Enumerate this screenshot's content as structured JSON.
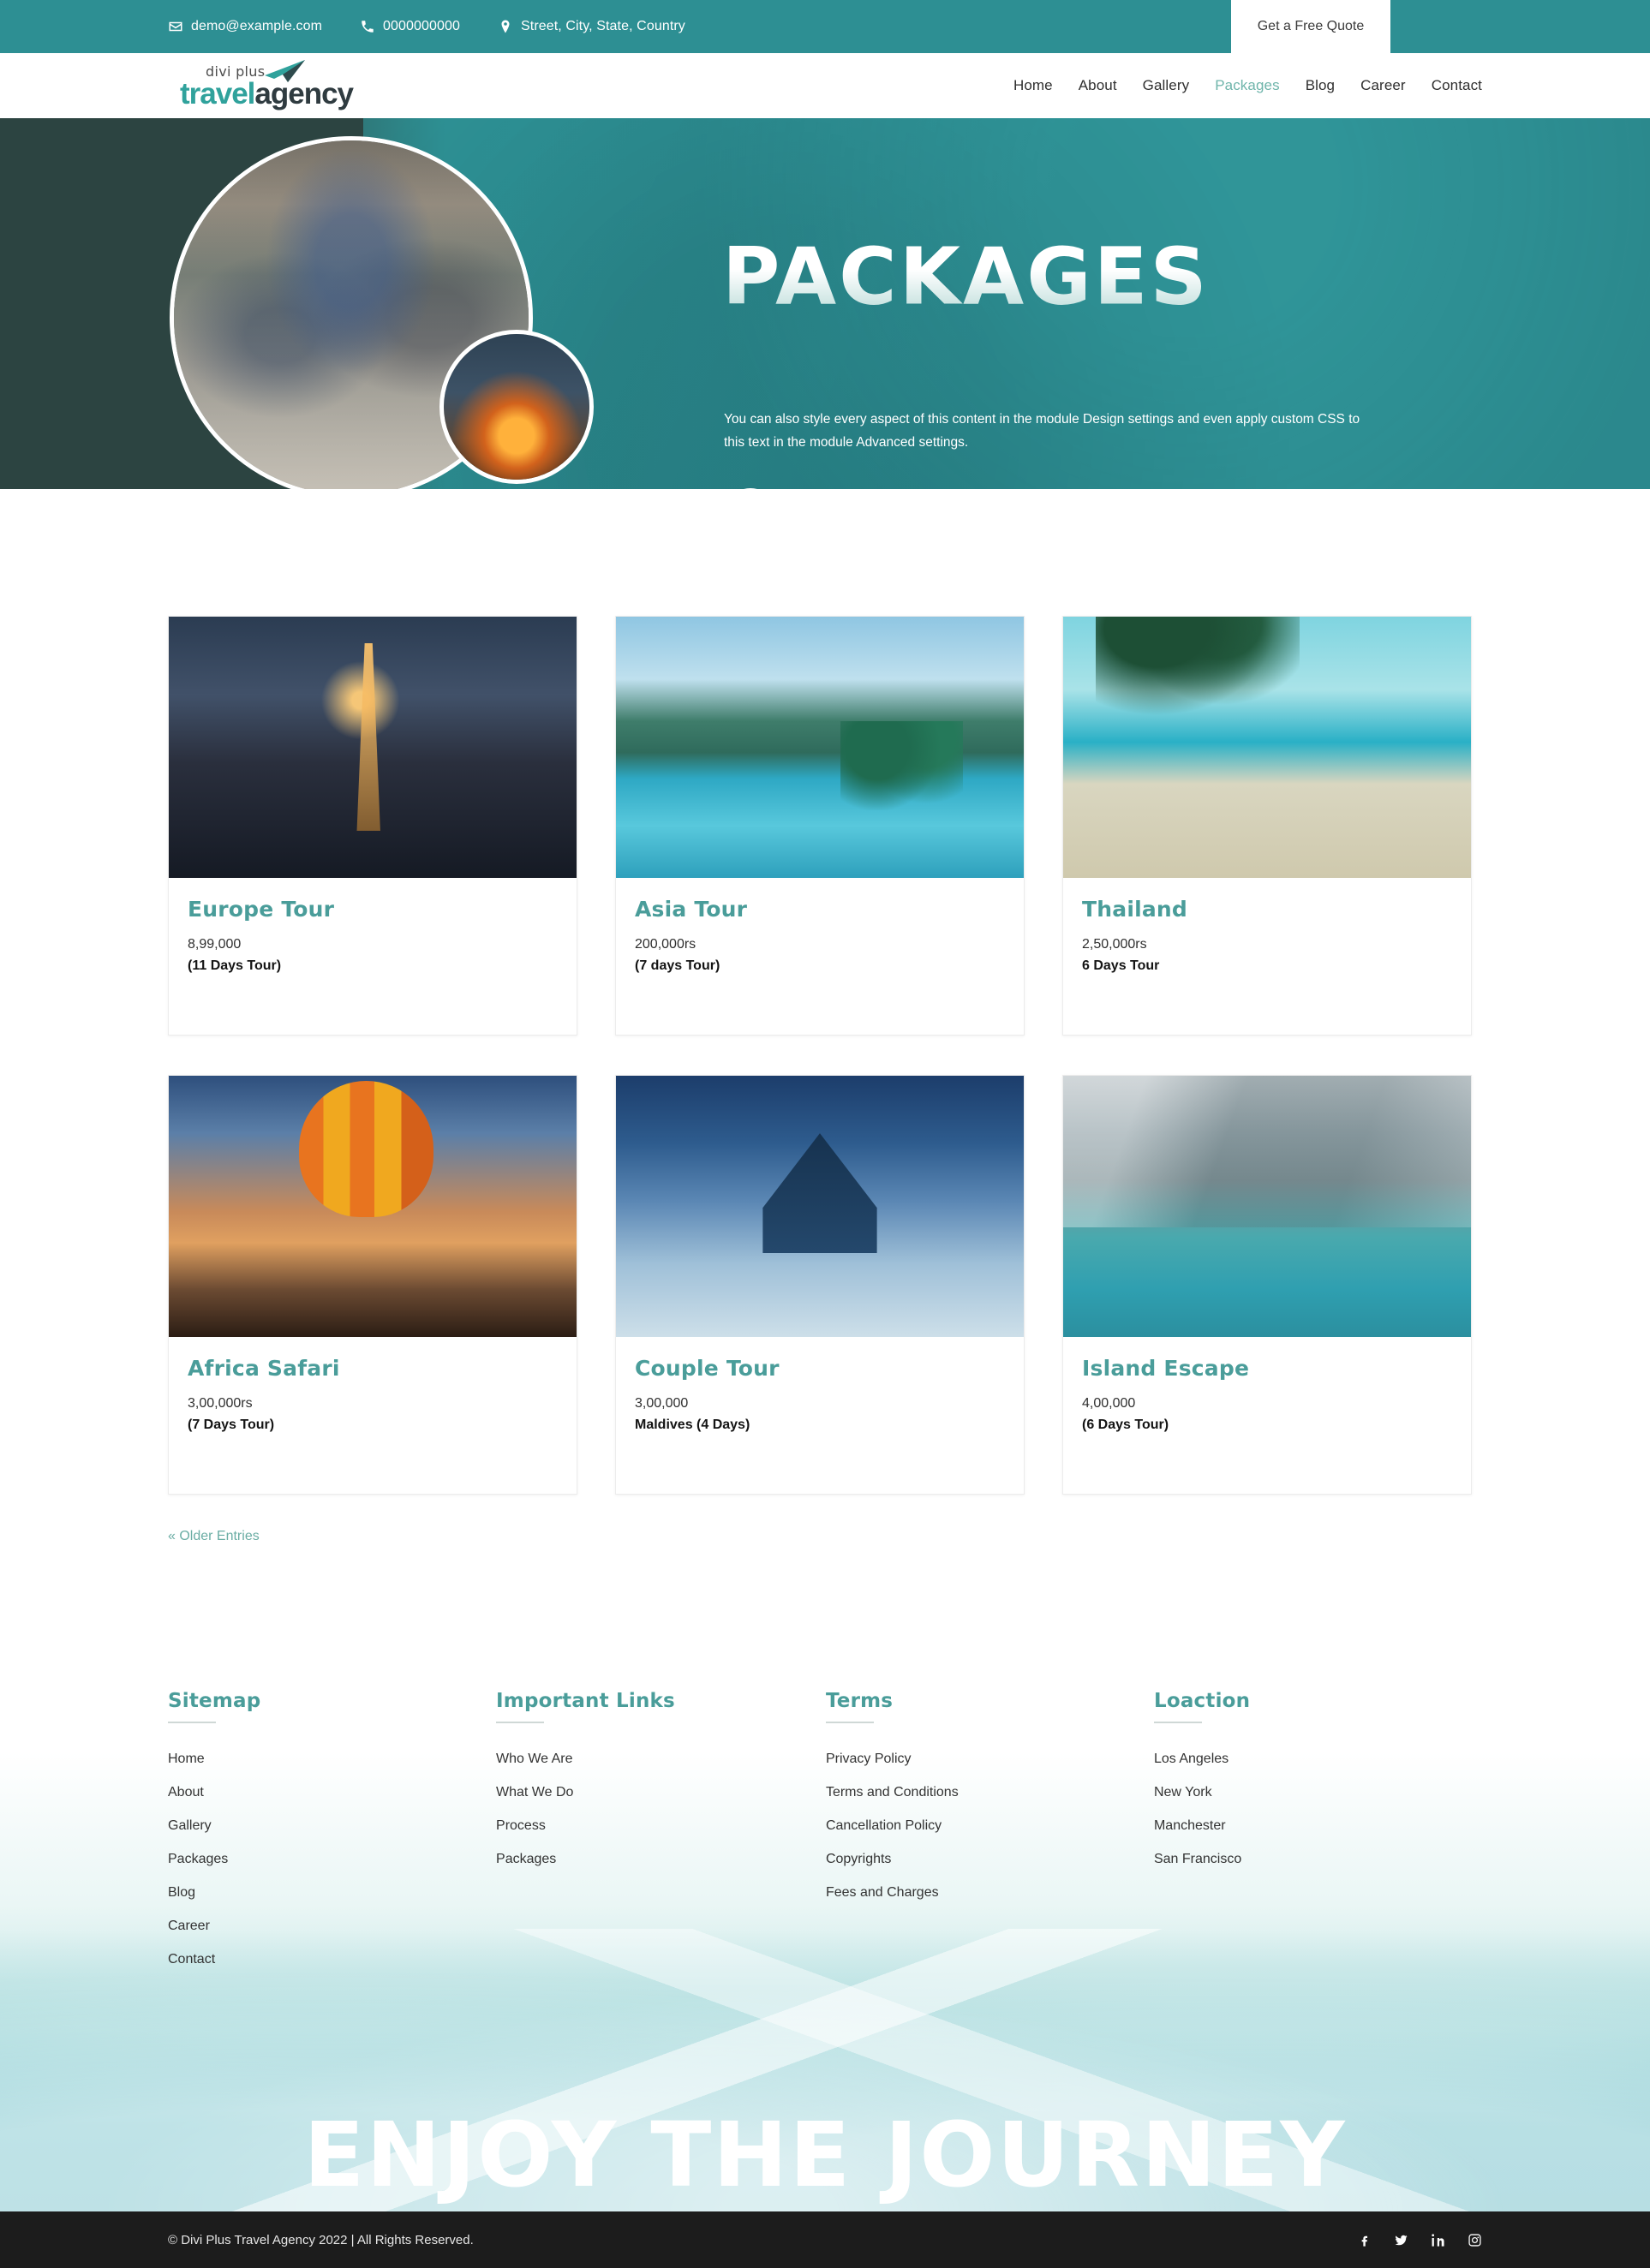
{
  "topbar": {
    "email": "demo@example.com",
    "phone": "0000000000",
    "address": "Street, City, State, Country",
    "quote_button": "Get a Free Quote",
    "bg_color": "#2d8f93"
  },
  "header": {
    "logo": {
      "small": "divi plus",
      "word1": "travel",
      "word2": "agency"
    },
    "nav": [
      {
        "label": "Home",
        "active": false
      },
      {
        "label": "About",
        "active": false
      },
      {
        "label": "Gallery",
        "active": false
      },
      {
        "label": "Packages",
        "active": true
      },
      {
        "label": "Blog",
        "active": false
      },
      {
        "label": "Career",
        "active": false
      },
      {
        "label": "Contact",
        "active": false
      }
    ],
    "active_color": "#6fb5ab"
  },
  "hero": {
    "title": "PACKAGES",
    "subtitle": "You can also style every aspect of this content in the module Design settings and even apply custom CSS to this text in the module Advanced settings.",
    "arrow_icon": "arrow-right-icon"
  },
  "packages": {
    "items": [
      {
        "title": "Europe Tour",
        "price": "8,99,000",
        "duration": "(11 Days Tour)",
        "photo": "p-eiffel"
      },
      {
        "title": "Asia Tour",
        "price": "200,000rs",
        "duration": "(7 days Tour)",
        "photo": "p-asia"
      },
      {
        "title": "Thailand",
        "price": "2,50,000rs",
        "duration": "6 Days Tour",
        "photo": "p-thailand"
      },
      {
        "title": "Africa Safari",
        "price": "3,00,000rs",
        "duration": "(7 Days Tour)",
        "photo": "p-balloon"
      },
      {
        "title": "Couple Tour",
        "price": "3,00,000",
        "duration": "Maldives (4 Days)",
        "photo": "p-snow"
      },
      {
        "title": "Island Escape",
        "price": "4,00,000",
        "duration": "(6 Days Tour)",
        "photo": "p-island"
      }
    ],
    "title_color": "#4a9d9a",
    "pagination": "« Older Entries"
  },
  "footer": {
    "columns": [
      {
        "title": "Sitemap",
        "links": [
          "Home",
          "About",
          "Gallery",
          "Packages",
          "Blog",
          "Career",
          "Contact"
        ]
      },
      {
        "title": "Important Links",
        "links": [
          "Who We Are",
          "What We Do",
          "Process",
          "Packages"
        ]
      },
      {
        "title": "Terms",
        "links": [
          "Privacy Policy",
          "Terms and Conditions",
          "Cancellation Policy",
          "Copyrights",
          "Fees and Charges"
        ]
      },
      {
        "title": "Loaction",
        "links": [
          "Los Angeles",
          "New York",
          "Manchester",
          "San Francisco"
        ]
      }
    ],
    "headline": "ENJOY THE JOURNEY"
  },
  "bottombar": {
    "copyright": "© Divi Plus Travel Agency 2022 | All Rights Reserved.",
    "socials": [
      "facebook-icon",
      "twitter-icon",
      "linkedin-icon",
      "instagram-icon"
    ],
    "bg_color": "#1c1c1c"
  }
}
